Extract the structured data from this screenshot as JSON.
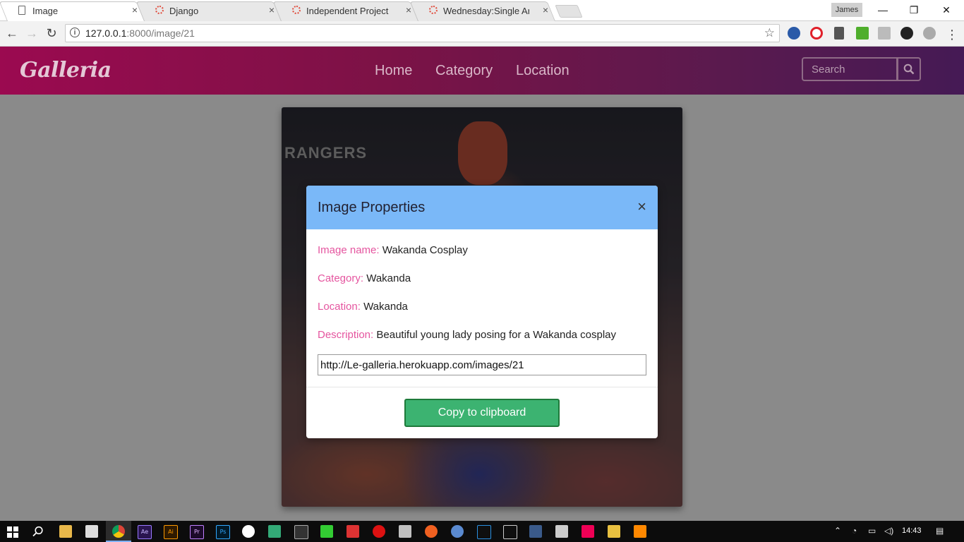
{
  "browser": {
    "tabs": [
      {
        "title": "Image",
        "active": true,
        "close": "×"
      },
      {
        "title": "Django",
        "active": false,
        "close": "×"
      },
      {
        "title": "Independent Project",
        "active": false,
        "close": "×"
      },
      {
        "title": "Wednesday:Single Article",
        "active": false,
        "close": "×"
      }
    ],
    "profile": "James",
    "window_controls": {
      "minimize": "—",
      "restore": "❐",
      "close": "✕"
    },
    "nav": {
      "back": "←",
      "forward": "→",
      "reload": "↻"
    },
    "url_host": "127.0.0.1",
    "url_rest": ":8000/image/21",
    "info_icon": "i",
    "star": "☆"
  },
  "site": {
    "brand": "Galleria",
    "nav": [
      "Home",
      "Category",
      "Location"
    ],
    "search_placeholder": "Search"
  },
  "photo": {
    "signage": "RANGERS"
  },
  "modal": {
    "title": "Image Properties",
    "close": "×",
    "image_name_label": "Image name:",
    "image_name": "Wakanda Cosplay",
    "category_label": "Category:",
    "category": "Wakanda",
    "location_label": "Location:",
    "location": "Wakanda",
    "description_label": "Description:",
    "description": "Beautiful young lady posing for a Wakanda cosplay",
    "link": "http://Le-galleria.herokuapp.com/images/21",
    "copy_button": "Copy to clipboard"
  },
  "taskbar": {
    "time": "14:43",
    "apps": [
      "Ae",
      "Ai",
      "Pr",
      "Ps"
    ]
  },
  "colors": {
    "nav_gradient_start": "#9b0a50",
    "nav_gradient_end": "#451a55",
    "modal_header": "#7ab8f8",
    "property_label": "#e5559f",
    "copy_button": "#3cb371"
  }
}
